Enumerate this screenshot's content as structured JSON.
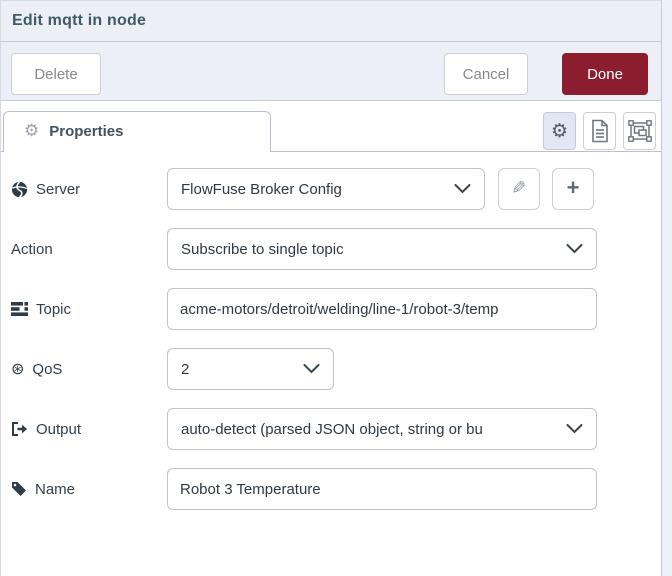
{
  "window": {
    "title": "Edit mqtt in node"
  },
  "actions": {
    "delete": "Delete",
    "cancel": "Cancel",
    "done": "Done"
  },
  "tabs": {
    "properties": "Properties"
  },
  "form": {
    "server": {
      "label": "Server",
      "value": "FlowFuse Broker Config"
    },
    "action": {
      "label": "Action",
      "value": "Subscribe to single topic"
    },
    "topic": {
      "label": "Topic",
      "value": "acme-motors/detroit/welding/line-1/robot-3/temp"
    },
    "qos": {
      "label": "QoS",
      "value": "2"
    },
    "output": {
      "label": "Output",
      "value": "auto-detect (parsed JSON object, string or bu"
    },
    "name": {
      "label": "Name",
      "value": "Robot 3 Temperature"
    }
  },
  "icons": {
    "gear": "⚙",
    "qos_circled_asterisk": "⊛",
    "pencil": "✎",
    "plus": "+"
  },
  "colors": {
    "done_button": "#8C1D2E",
    "header_text": "#3F5A66",
    "panel_background": "#EDEFF6",
    "active_icon_button_bg": "#E3E6F3"
  }
}
